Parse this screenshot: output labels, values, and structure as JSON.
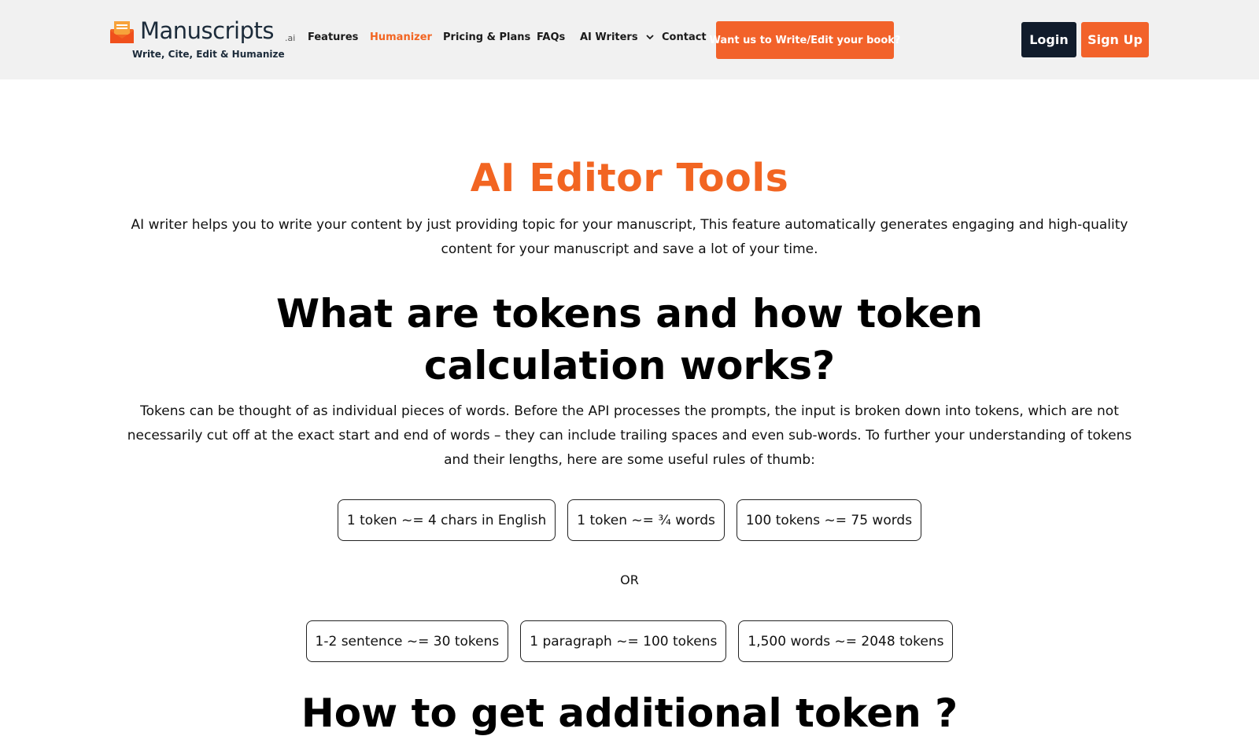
{
  "header": {
    "logo": {
      "name": "Manuscripts",
      "suffix": ".ai",
      "tagline": "Write, Cite, Edit & Humanize"
    },
    "nav": [
      {
        "label": "Features"
      },
      {
        "label": "Humanizer",
        "active": true
      },
      {
        "label": "Pricing & Plans"
      },
      {
        "label": "FAQs"
      },
      {
        "label": "AI Writers",
        "dropdown": true
      },
      {
        "label": "Contact"
      }
    ],
    "cta": "Want us to Write/Edit your book?",
    "login": "Login",
    "signup": "Sign Up"
  },
  "colors": {
    "accent": "#f26522",
    "dark_button": "#111c2b",
    "header_bg": "#f1f1f1"
  },
  "icons": {
    "logo": "open-envelope-icon",
    "dropdown": "chevron-down-icon"
  },
  "main": {
    "title": "AI Editor Tools",
    "intro": "AI writer helps you to write your content by just providing topic for your manuscript, This feature automatically generates engaging and high-quality content for your manuscript and save a lot of your time.",
    "tokens_heading": "What are tokens and how token calculation works?",
    "tokens_para": "Tokens can be thought of as individual pieces of words. Before the API processes the prompts, the input is broken down into tokens, which are not necessarily cut off at the exact start and end of words – they can include trailing spaces and even sub-words. To further your understanding of tokens and their lengths, here are some useful rules of thumb:",
    "rules_row1": [
      "1 token ~= 4 chars in English",
      "1 token ~= ¾ words",
      "100 tokens ~= 75 words"
    ],
    "or_text": "OR",
    "rules_row2": [
      "1-2 sentence ~= 30 tokens",
      "1 paragraph ~= 100 tokens",
      "1,500 words ~= 2048 tokens"
    ],
    "next_heading": "How to get additional token ?"
  }
}
